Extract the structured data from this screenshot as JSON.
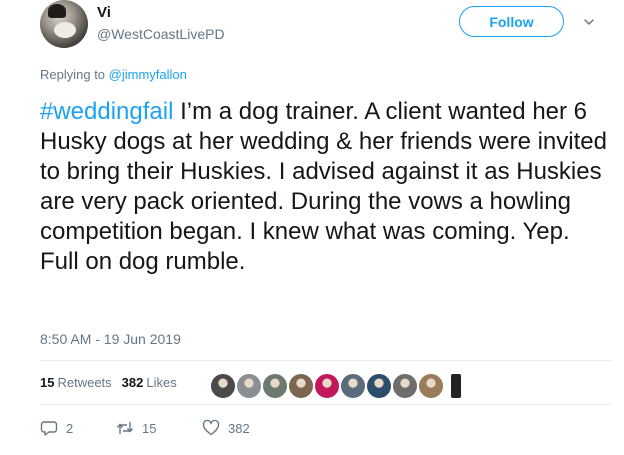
{
  "user": {
    "display_name": "Vi",
    "handle": "@WestCoastLivePD"
  },
  "follow_label": "Follow",
  "reply_to": {
    "prefix": "Replying to ",
    "handle": "@jimmyfallon"
  },
  "tweet": {
    "hashtag": "#weddingfail",
    "body": " I’m a dog trainer. A client wanted her 6 Husky dogs at her wedding & her friends were invited to bring their Huskies. I advised against it as Huskies are very pack oriented. During the vows a howling competition began. I knew what was coming. Yep. Full on dog rumble."
  },
  "timestamp": "8:50 AM - 19 Jun 2019",
  "stats": {
    "retweets_count": "15",
    "retweets_label": "Retweets",
    "likes_count": "382",
    "likes_label": "Likes"
  },
  "liker_avatars": [
    {
      "icon": "avatar-dog-icon",
      "color": "#4a4a4a"
    },
    {
      "icon": "avatar-person-icon",
      "color": "#8a8f94"
    },
    {
      "icon": "avatar-person-icon",
      "color": "#6b7a6e"
    },
    {
      "icon": "avatar-person-icon",
      "color": "#7c6650"
    },
    {
      "icon": "avatar-person-icon",
      "color": "#c2185b"
    },
    {
      "icon": "avatar-person-icon",
      "color": "#5a6b7d"
    },
    {
      "icon": "avatar-person-icon",
      "color": "#2e4d6b"
    },
    {
      "icon": "avatar-person-icon",
      "color": "#6d6d6d"
    },
    {
      "icon": "avatar-person-icon",
      "color": "#9a7b5a"
    }
  ],
  "actions": {
    "replies": "2",
    "retweets": "15",
    "likes": "382"
  },
  "colors": {
    "accent": "#1da1f2",
    "secondary_text": "#657786",
    "primary_text": "#14171a"
  }
}
